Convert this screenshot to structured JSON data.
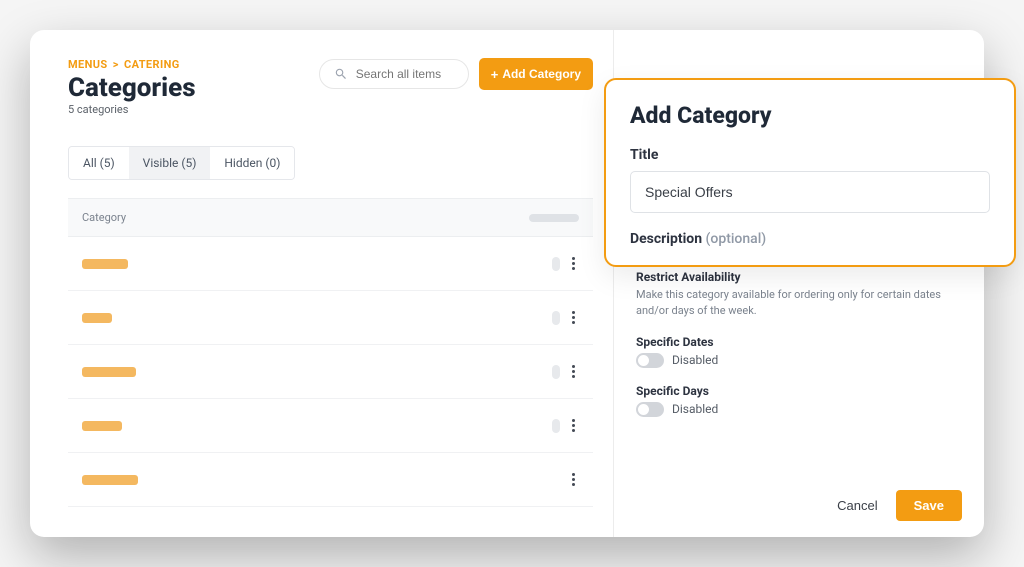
{
  "breadcrumb": {
    "root": "MENUS",
    "current": "CATERING"
  },
  "page": {
    "title": "Categories",
    "subtitle": "5 categories"
  },
  "search": {
    "placeholder": "Search all items"
  },
  "buttons": {
    "add_category": "Add Category",
    "cancel": "Cancel",
    "save": "Save"
  },
  "tabs": {
    "all": "All (5)",
    "visible": "Visible (5)",
    "hidden": "Hidden (0)"
  },
  "table": {
    "header_category": "Category"
  },
  "sidepanel": {
    "restrict_title": "Restrict Availability",
    "restrict_sub": "Make this category available for ordering only for certain dates and/or days of the week.",
    "specific_dates_title": "Specific Dates",
    "specific_days_title": "Specific Days",
    "disabled_label": "Disabled"
  },
  "overlay": {
    "heading": "Add Category",
    "title_label": "Title",
    "title_value": "Special Offers",
    "description_label": "Description",
    "description_optional": "(optional)"
  }
}
